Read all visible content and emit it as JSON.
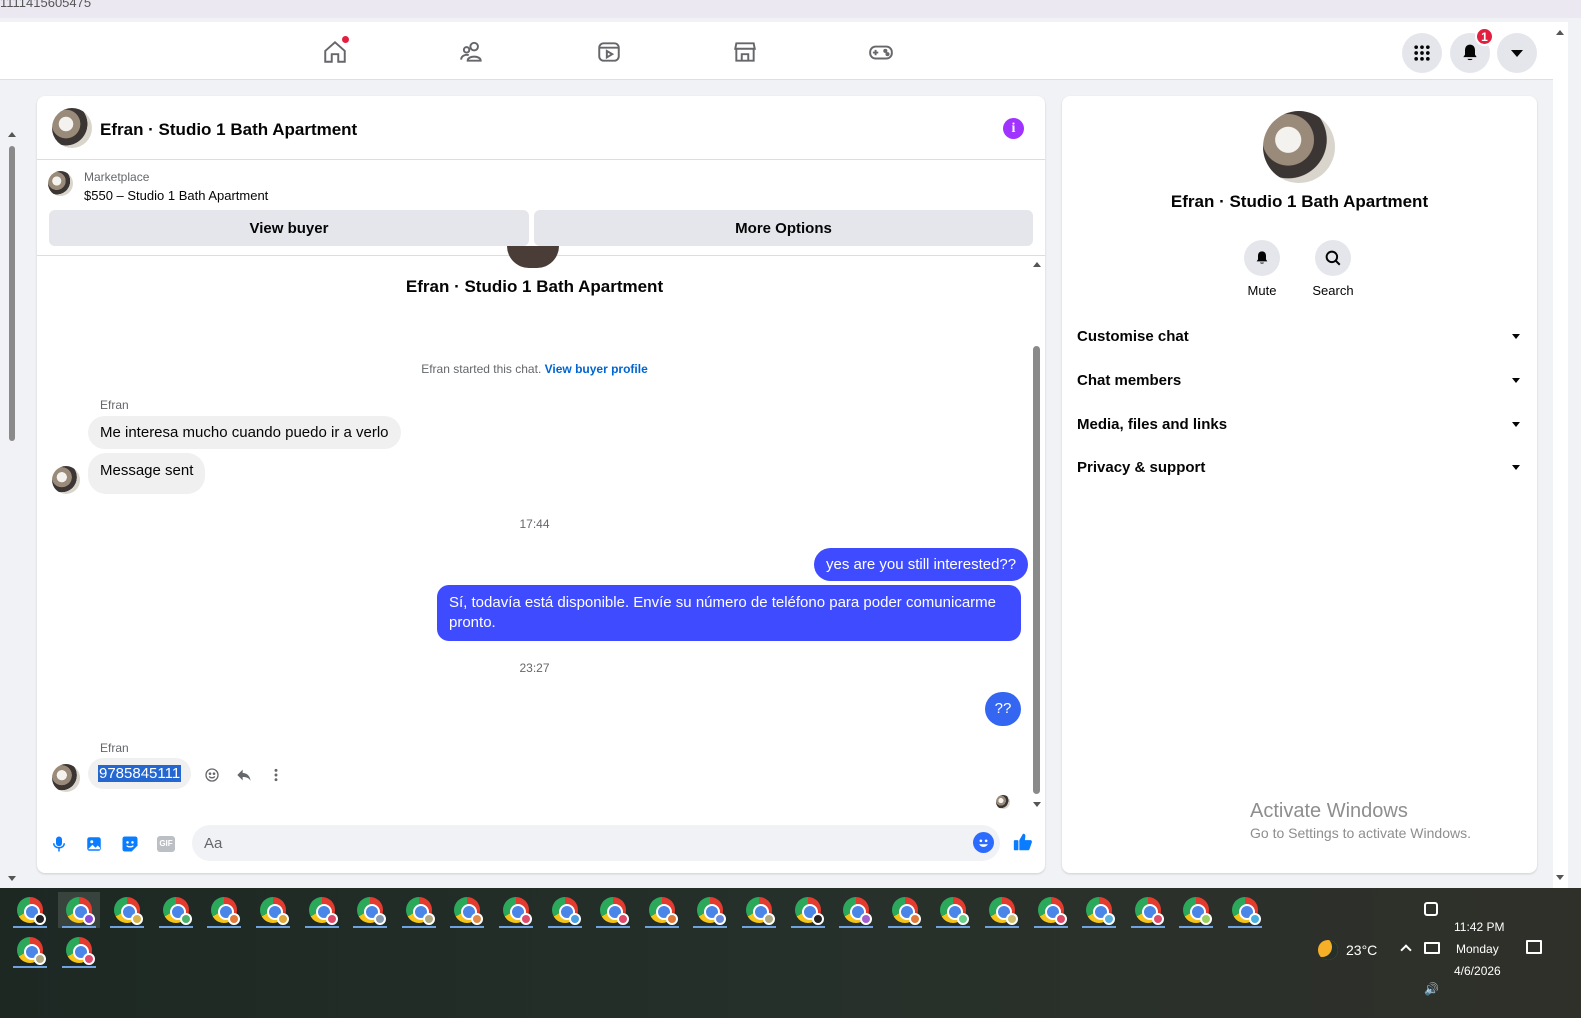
{
  "browser": {
    "url_fragment": "1111415605475"
  },
  "nav": {
    "notifications_badge": "1"
  },
  "chat": {
    "title": "Efran · Studio 1 Bath Apartment",
    "marketplace_label": "Marketplace",
    "listing": "$550 – Studio 1 Bath Apartment",
    "view_buyer": "View buyer",
    "more_options": "More Options",
    "thread_name": "Efran · Studio 1 Bath Apartment",
    "started_text": "Efran started this chat.",
    "view_buyer_profile": "View buyer profile",
    "messages": [
      {
        "sender": "Efran",
        "text": "Me interesa mucho cuando puedo ir a verlo"
      },
      {
        "text": "Message sent"
      },
      {
        "time": "17:44"
      },
      {
        "text": "yes are you still interested??"
      },
      {
        "text": "Sí, todavía está disponible. Envíe su número de teléfono para poder comunicarme pronto."
      },
      {
        "time": "23:27"
      },
      {
        "text": "??"
      },
      {
        "sender": "Efran",
        "text": "9785845111"
      }
    ],
    "composer_placeholder": "Aa",
    "gif_label": "GIF"
  },
  "info": {
    "name": "Efran · Studio 1 Bath Apartment",
    "mute": "Mute",
    "search": "Search",
    "sections": [
      "Customise chat",
      "Chat members",
      "Media, files and links",
      "Privacy & support"
    ]
  },
  "watermark": {
    "line1": "Activate Windows",
    "line2": "Go to Settings to activate Windows."
  },
  "taskbar": {
    "weather_temp": "23°C",
    "time": "11:42 PM",
    "day": "Monday",
    "date": "4/6/2026"
  },
  "colors": {
    "outgoing_bubble": "#3e4bff",
    "link": "#0064d1",
    "accent": "#a033ff",
    "badge": "#e41e3f"
  }
}
